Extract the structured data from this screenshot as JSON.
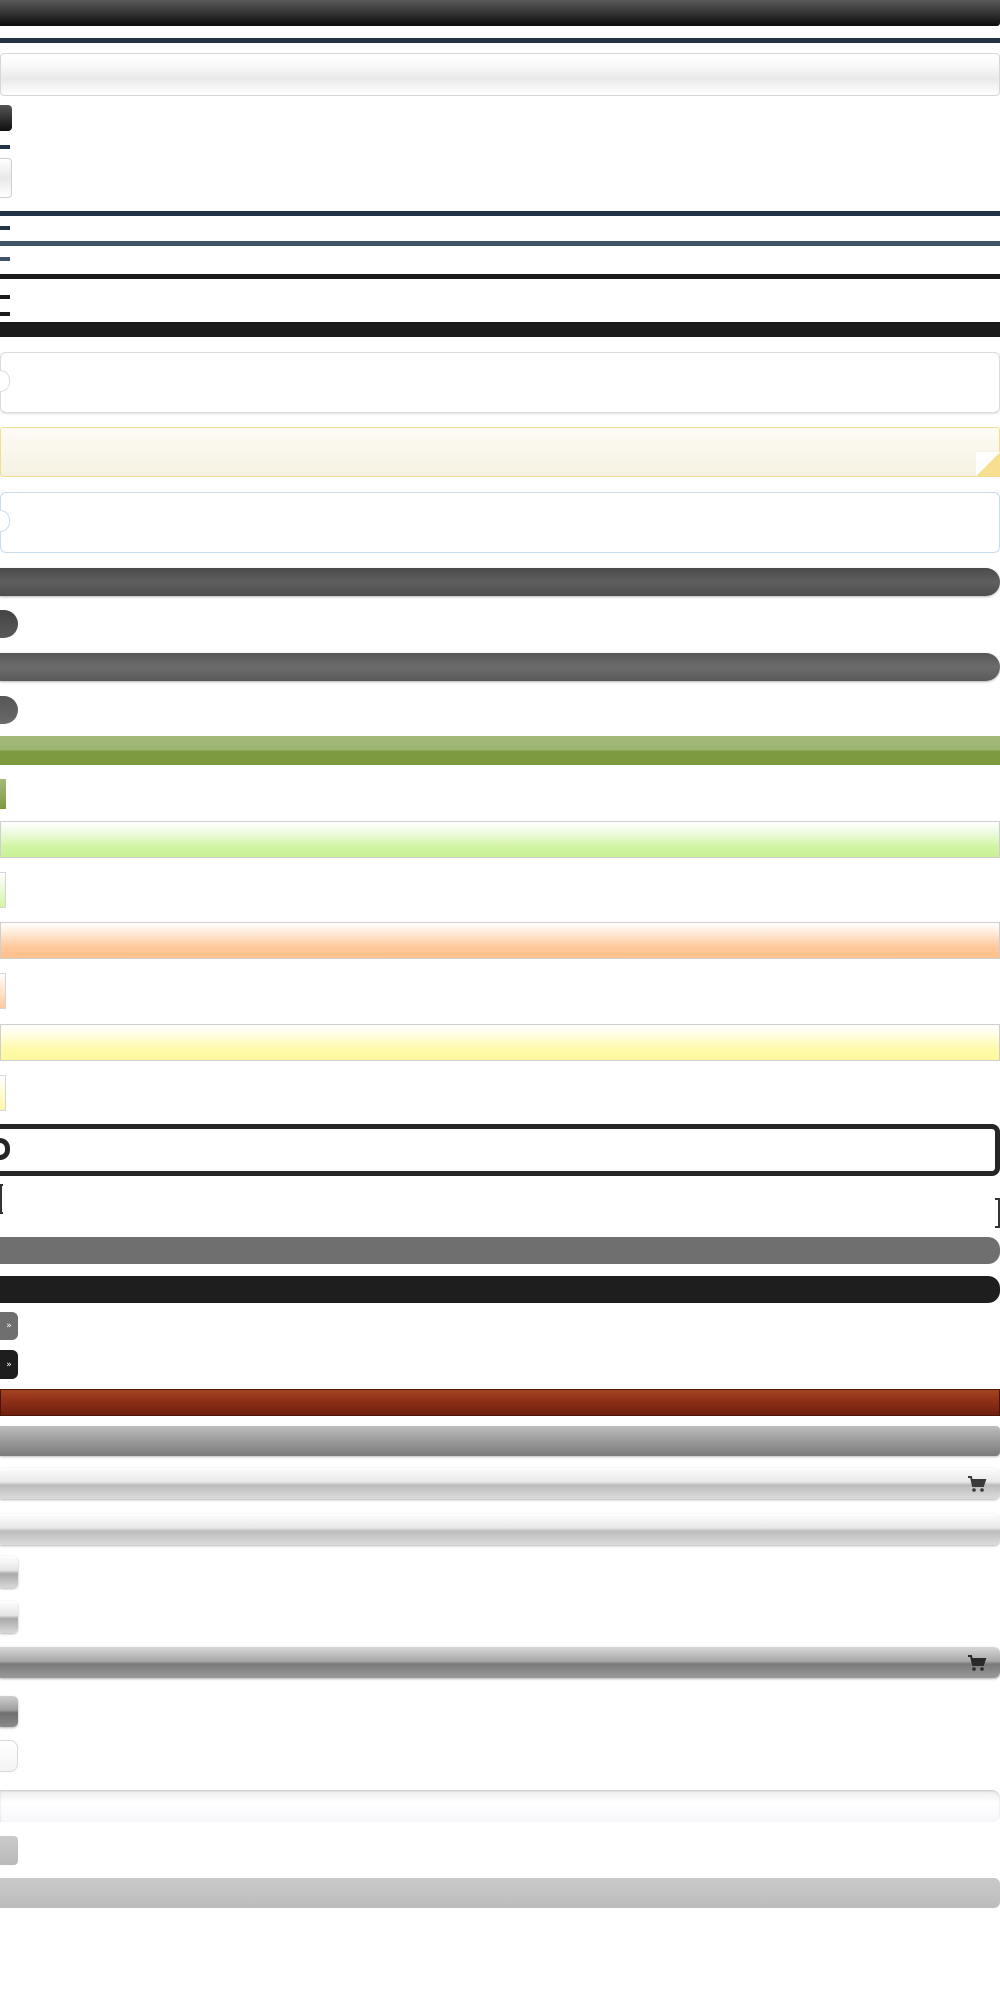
{
  "colors": {
    "black_bar": "#1b1b1b",
    "navy_line": "#243447",
    "slate_line": "#3e5366",
    "dark_gray": "#555555",
    "olive_green": "#86a04a",
    "lime": "#d2f5a4",
    "peach": "#ffc89a",
    "light_yellow": "#fffaa8",
    "rust": "#8a2d17",
    "silver": "#c6c6c6",
    "note_border": "#f3dd8e"
  },
  "icons": {
    "double_chevron": "»",
    "cart": "cart-icon"
  }
}
